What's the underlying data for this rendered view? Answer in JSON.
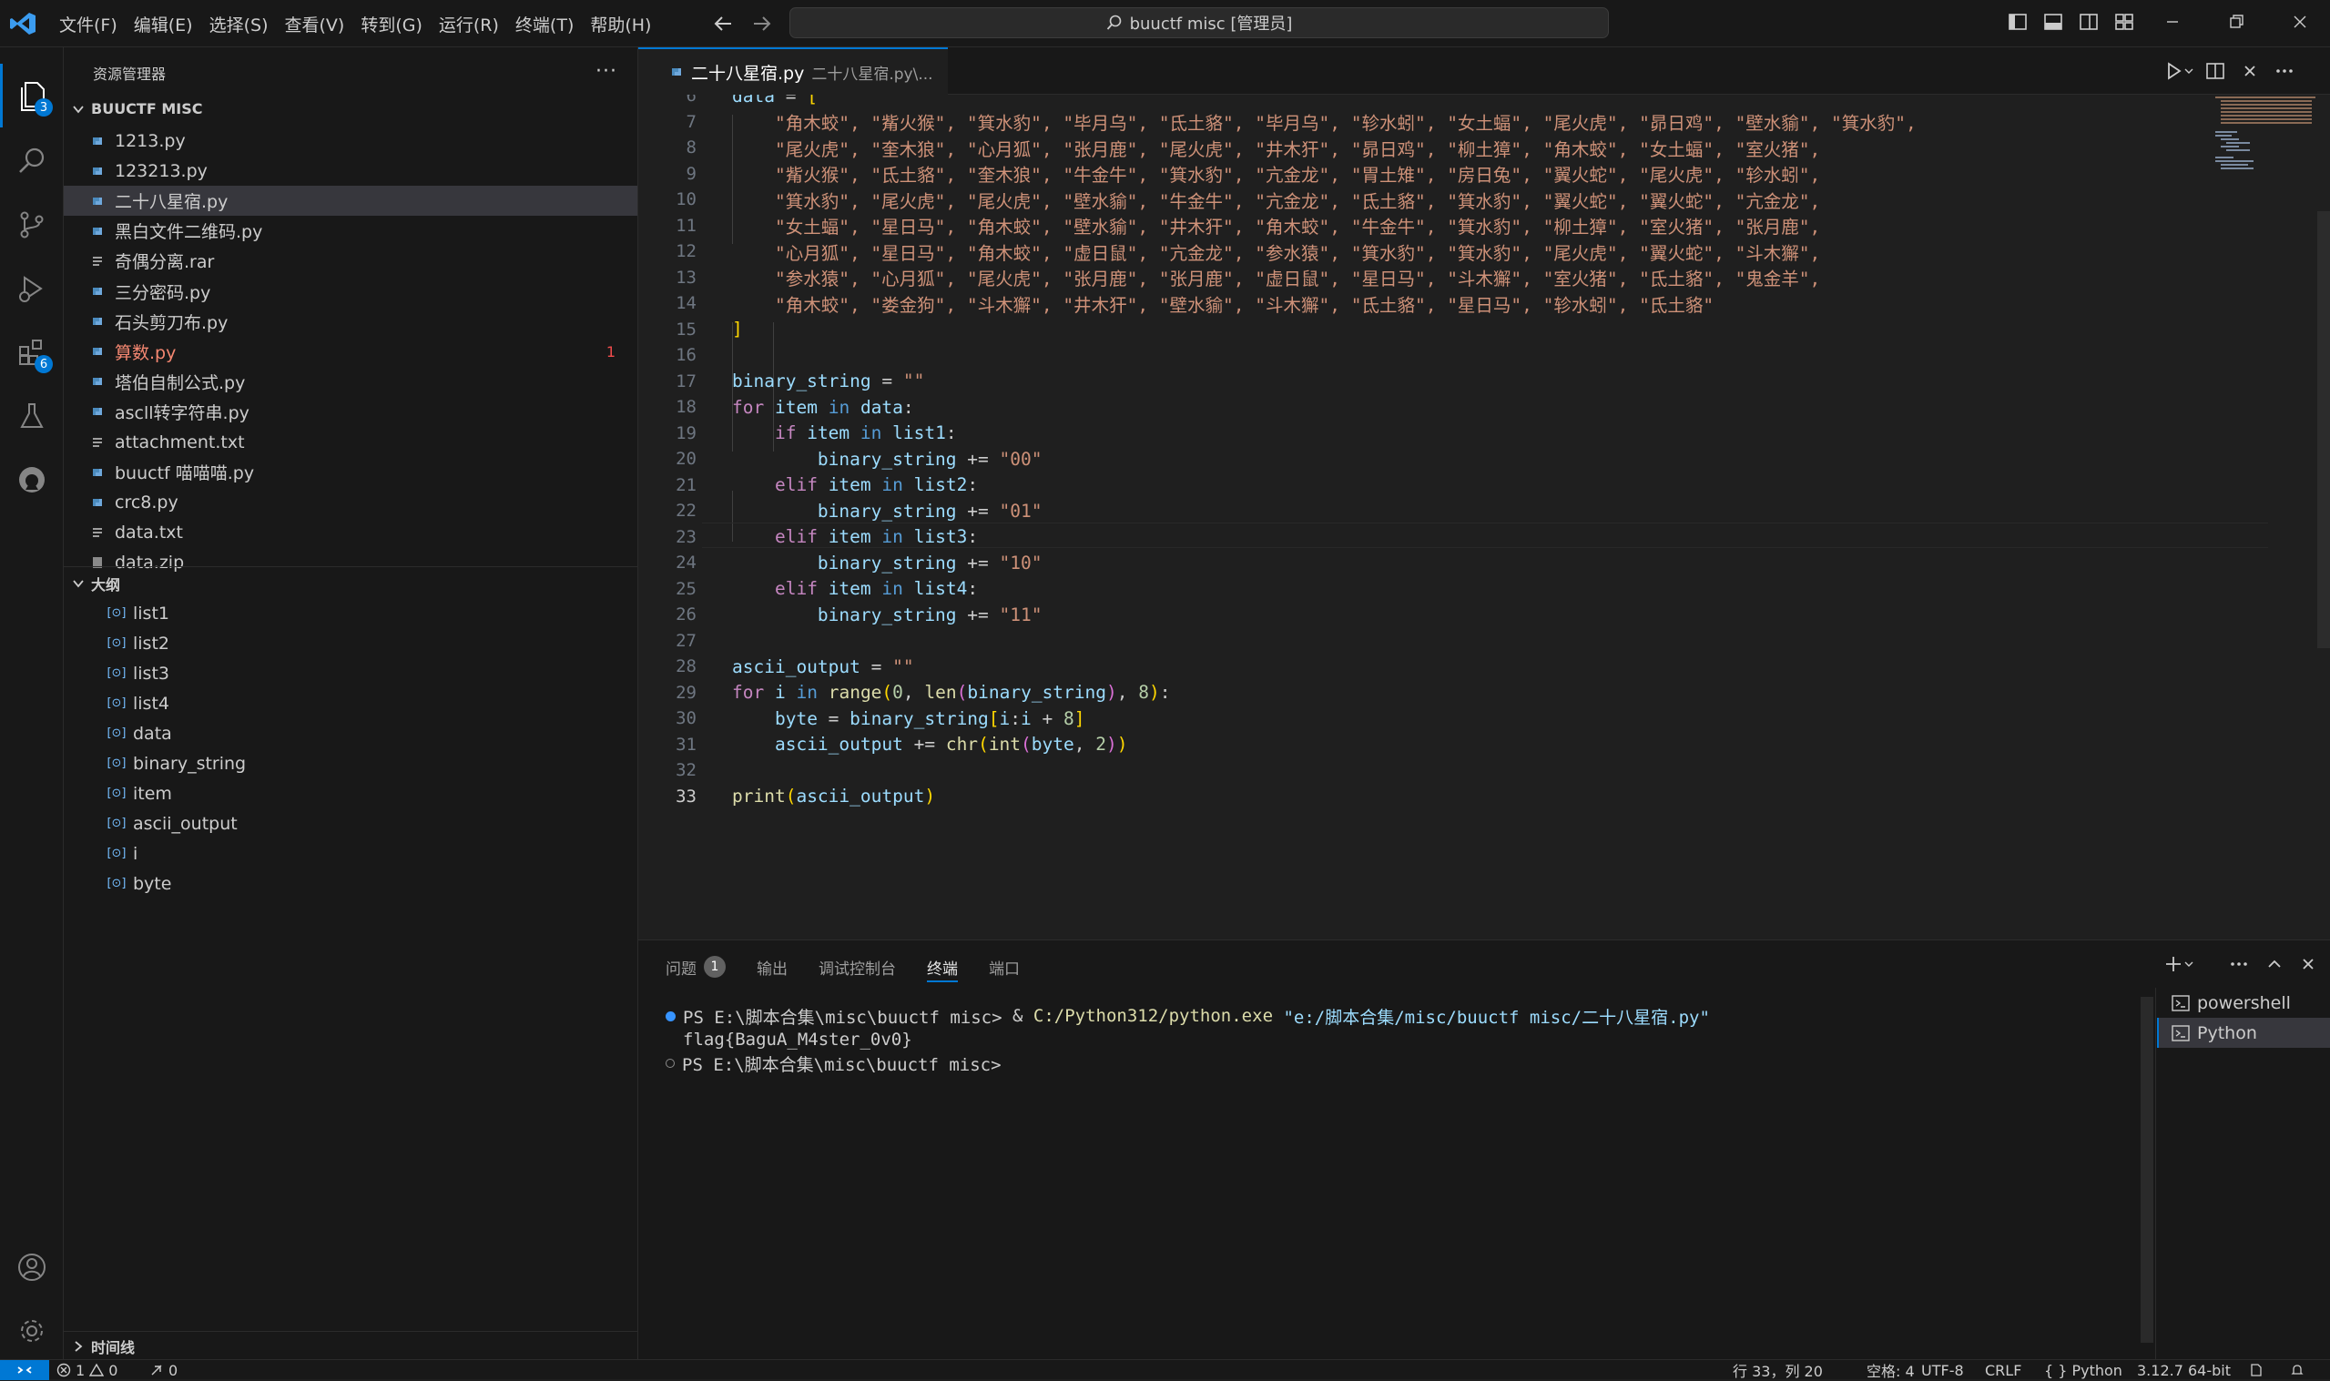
{
  "titlebar": {
    "menus": [
      "文件(F)",
      "编辑(E)",
      "选择(S)",
      "查看(V)",
      "转到(G)",
      "运行(R)",
      "终端(T)",
      "帮助(H)"
    ],
    "search_text": "buuctf misc [管理员]"
  },
  "activity": {
    "explorer_badge": "3",
    "extensions_badge": "6"
  },
  "sidebar": {
    "header": "资源管理器",
    "more": "···",
    "folder_title": "BUUCTF MISC",
    "files": [
      {
        "name": "1213.py",
        "type": "py"
      },
      {
        "name": "123213.py",
        "type": "py"
      },
      {
        "name": "二十八星宿.py",
        "type": "py"
      },
      {
        "name": "黑白文件二维码.py",
        "type": "py"
      },
      {
        "name": "奇偶分离.rar",
        "type": "txt"
      },
      {
        "name": "三分密码.py",
        "type": "py"
      },
      {
        "name": "石头剪刀布.py",
        "type": "py"
      },
      {
        "name": "算数.py",
        "type": "py"
      },
      {
        "name": "塔伯自制公式.py",
        "type": "py"
      },
      {
        "name": "ascll转字符串.py",
        "type": "py"
      },
      {
        "name": "attachment.txt",
        "type": "txt"
      },
      {
        "name": "buuctf 喵喵喵.py",
        "type": "py"
      },
      {
        "name": "crc8.py",
        "type": "py"
      },
      {
        "name": "data.txt",
        "type": "txt"
      },
      {
        "name": "data.zip",
        "type": "zip"
      }
    ],
    "error_count": "1",
    "outline_title": "大纲",
    "outline": [
      "list1",
      "list2",
      "list3",
      "list4",
      "data",
      "binary_string",
      "item",
      "ascii_output",
      "i",
      "byte"
    ],
    "timeline_title": "时间线"
  },
  "editor": {
    "tab_name": "二十八星宿.py",
    "tab_path": "二十八星宿.py\\...",
    "line_numbers": [
      "6",
      "7",
      "8",
      "9",
      "10",
      "11",
      "12",
      "13",
      "14",
      "15",
      "16",
      "17",
      "18",
      "19",
      "20",
      "21",
      "22",
      "23",
      "24",
      "25",
      "26",
      "27",
      "28",
      "29",
      "30",
      "31",
      "32",
      "33"
    ],
    "data_rows": [
      "\"角木蛟\", \"觜火猴\", \"箕水豹\", \"毕月乌\", \"氐土貉\", \"毕月乌\", \"轸水蚓\", \"女土蝠\", \"尾火虎\", \"昴日鸡\", \"壁水貐\", \"箕水豹\",",
      "\"尾火虎\", \"奎木狼\", \"心月狐\", \"张月鹿\", \"尾火虎\", \"井木犴\", \"昴日鸡\", \"柳土獐\", \"角木蛟\", \"女土蝠\", \"室火猪\",",
      "\"觜火猴\", \"氐土貉\", \"奎木狼\", \"牛金牛\", \"箕水豹\", \"亢金龙\", \"胃土雉\", \"房日兔\", \"翼火蛇\", \"尾火虎\", \"轸水蚓\",",
      "\"箕水豹\", \"尾火虎\", \"尾火虎\", \"壁水貐\", \"牛金牛\", \"亢金龙\", \"氐土貉\", \"箕水豹\", \"翼火蛇\", \"翼火蛇\", \"亢金龙\",",
      "\"女土蝠\", \"星日马\", \"角木蛟\", \"壁水貐\", \"井木犴\", \"角木蛟\", \"牛金牛\", \"箕水豹\", \"柳土獐\", \"室火猪\", \"张月鹿\",",
      "\"心月狐\", \"星日马\", \"角木蛟\", \"虚日鼠\", \"亢金龙\", \"参水猿\", \"箕水豹\", \"箕水豹\", \"尾火虎\", \"翼火蛇\", \"斗木獬\",",
      "\"参水猿\", \"心月狐\", \"尾火虎\", \"张月鹿\", \"张月鹿\", \"虚日鼠\", \"星日马\", \"斗木獬\", \"室火猪\", \"氐土貉\", \"鬼金羊\",",
      "\"角木蛟\", \"娄金狗\", \"斗木獬\", \"井木犴\", \"壁水貐\", \"斗木獬\", \"氐土貉\", \"星日马\", \"轸水蚓\", \"氐土貉\""
    ]
  },
  "panel": {
    "tabs": [
      "问题",
      "输出",
      "调试控制台",
      "终端",
      "端口"
    ],
    "problems_count": "1",
    "terminal": {
      "prompt": "PS E:\\脚本合集\\misc\\buuctf misc>",
      "cmd_amp": "&",
      "cmd_exe": "C:/Python312/python.exe",
      "cmd_arg": "\"e:/脚本合集/misc/buuctf misc/二十八星宿.py\"",
      "output": "flag{BaguA_M4ster_0v0}",
      "prompt2": "PS E:\\脚本合集\\misc\\buuctf misc>"
    },
    "terminals": [
      "powershell",
      "Python"
    ]
  },
  "statusbar": {
    "errors": "1",
    "warnings": "0",
    "ports": "0",
    "position": "行 33，列 20",
    "spaces": "空格: 4",
    "encoding": "UTF-8",
    "eol": "CRLF",
    "language": "Python",
    "interpreter": "3.12.7 64-bit"
  },
  "colors": {
    "accent": "#0078d4",
    "error": "#f14c4c",
    "string": "#ce9178",
    "keyword": "#c586c0",
    "variable": "#9cdcfe"
  }
}
